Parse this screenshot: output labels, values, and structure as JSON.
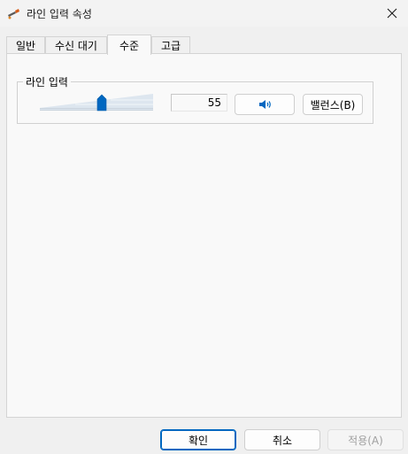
{
  "window": {
    "title": "라인 입력 속성",
    "close_icon": "close-icon"
  },
  "tabs": [
    {
      "label": "일반",
      "active": false
    },
    {
      "label": "수신 대기",
      "active": false
    },
    {
      "label": "수준",
      "active": true
    },
    {
      "label": "고급",
      "active": false
    }
  ],
  "levels": {
    "group_label": "라인 입력",
    "volume_value": "55",
    "volume_fraction": 0.55,
    "speaker_icon": "speaker-icon",
    "balance_label": "밸런스(B)"
  },
  "footer": {
    "ok_label": "확인",
    "cancel_label": "취소",
    "apply_label": "적용(A)"
  },
  "colors": {
    "accent": "#0067c0"
  }
}
